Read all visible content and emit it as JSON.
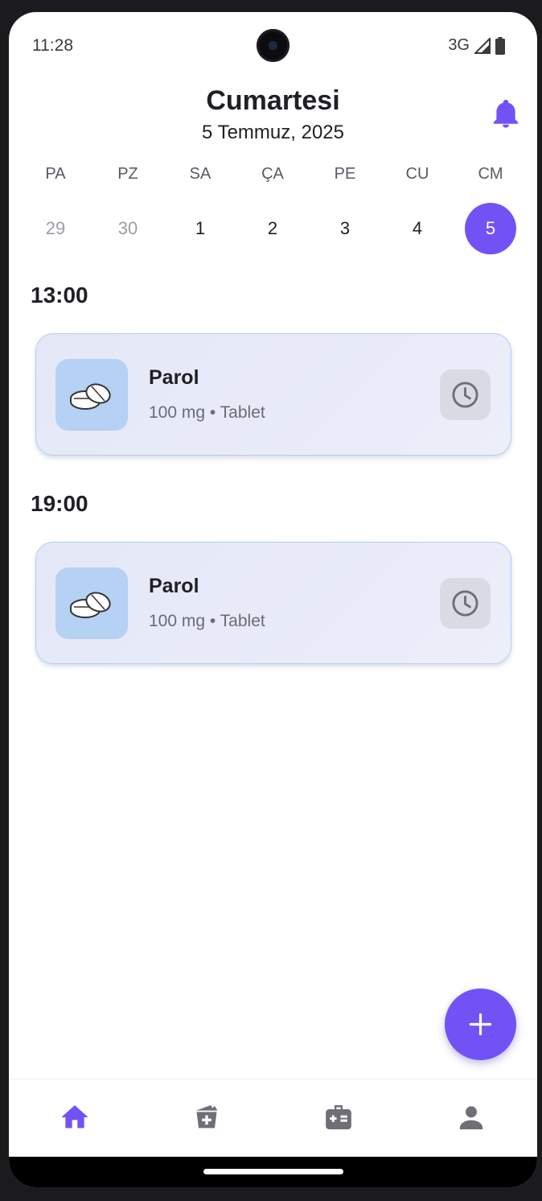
{
  "status": {
    "time": "11:28",
    "network": "3G"
  },
  "header": {
    "day": "Cumartesi",
    "date": "5 Temmuz, 2025",
    "bell_icon": "bell-icon"
  },
  "week": [
    {
      "name": "PA",
      "num": "29"
    },
    {
      "name": "PZ",
      "num": "30"
    },
    {
      "name": "SA",
      "num": "1"
    },
    {
      "name": "ÇA",
      "num": "2"
    },
    {
      "name": "PE",
      "num": "3"
    },
    {
      "name": "CU",
      "num": "4"
    },
    {
      "name": "CM",
      "num": "5"
    }
  ],
  "schedule": [
    {
      "time": "13:00",
      "med": {
        "name": "Parol",
        "detail": "100 mg • Tablet"
      }
    },
    {
      "time": "19:00",
      "med": {
        "name": "Parol",
        "detail": "100 mg • Tablet"
      }
    }
  ],
  "nav": [
    "home-icon",
    "medicine-icon",
    "medical-kit-icon",
    "profile-icon"
  ],
  "colors": {
    "accent": "#7352f5",
    "card_bg": "#e6e9f7",
    "pill_bg": "#b5d1f4",
    "icon_gray": "#6f6f78"
  }
}
